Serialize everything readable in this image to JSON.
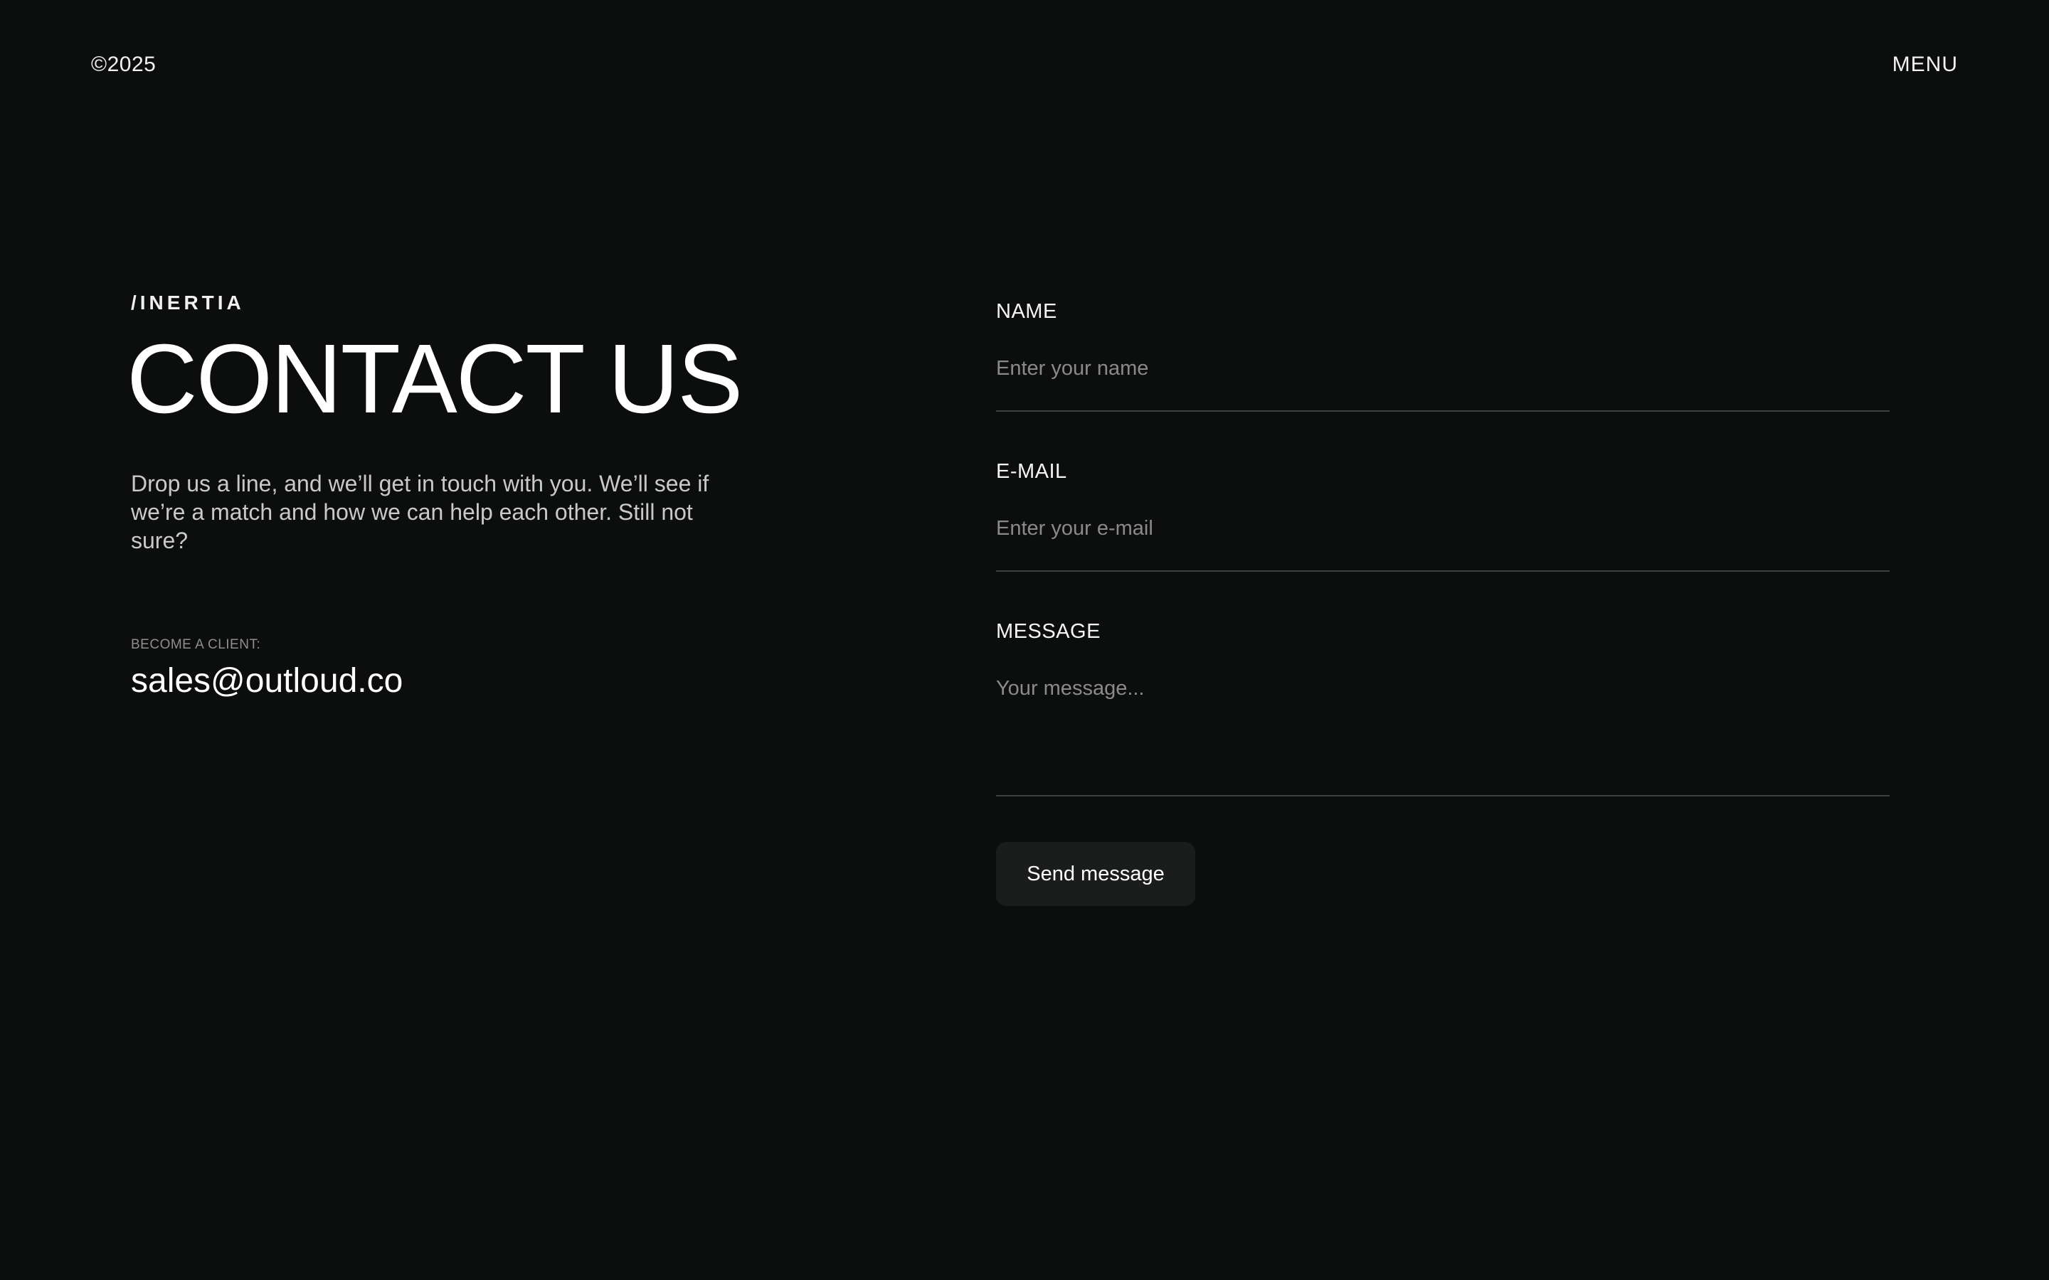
{
  "header": {
    "copyright": "©2025",
    "menu_label": "MENU"
  },
  "hero": {
    "eyebrow": "/INERTIA",
    "title": "CONTACT US",
    "intro": "Drop us a line, and we’ll get in touch with you. We’ll see if we’re a match and how we can help each other. Still not sure?",
    "client_label": "BECOME A CLIENT:",
    "client_email": "sales@outloud.co"
  },
  "form": {
    "name": {
      "label": "NAME",
      "placeholder": "Enter your name",
      "value": ""
    },
    "email": {
      "label": "E-MAIL",
      "placeholder": "Enter your e-mail",
      "value": ""
    },
    "message": {
      "label": "MESSAGE",
      "placeholder": "Your message...",
      "value": ""
    },
    "submit_label": "Send message"
  },
  "colors": {
    "background": "#0c0e0d",
    "text": "#ffffff",
    "muted_text": "#8a8b89",
    "divider": "#3f4140",
    "button_bg": "#1b1c1c"
  }
}
